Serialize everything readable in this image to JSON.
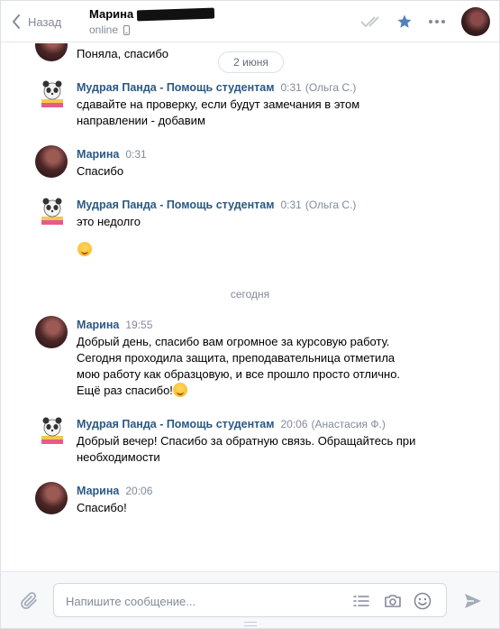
{
  "header": {
    "back_label": "Назад",
    "peer_name": "Марина",
    "peer_status": "online",
    "icons": [
      "double-check-icon",
      "star-icon",
      "more-icon"
    ]
  },
  "messages_area": {
    "date_pill": "2 июня",
    "today_separator": "сегодня"
  },
  "messages": [
    {
      "text": "Поняла, спасибо"
    },
    {
      "author": "Мудрая Панда - Помощь студентам",
      "time": "0:31",
      "sub": "(Ольга С.)",
      "text": "сдавайте на проверку, если будут замечания в этом направлении - добавим"
    },
    {
      "author": "Марина",
      "time": "0:31",
      "text": "Спасибо"
    },
    {
      "author": "Мудрая Панда - Помощь студентам",
      "time": "0:31",
      "sub": "(Ольга С.)",
      "text": "это недолго",
      "emoji": "smile-emoji"
    },
    {
      "author": "Марина",
      "time": "19:55",
      "text": "Добрый день, спасибо вам огромное за курсовую работу. Сегодня проходила защита, преподавательница отметила мою работу как образцовую, и все прошло просто отлично. Ещё раз спасибо!"
    },
    {
      "author": "Мудрая Панда - Помощь студентам",
      "time": "20:06",
      "sub": "(Анастасия Ф.)",
      "text": "Добрый вечер! Спасибо за обратную связь. Обращайтесь при необходимости"
    },
    {
      "author": "Марина",
      "time": "20:06",
      "text": "Спасибо!"
    }
  ],
  "composer": {
    "placeholder": "Напишите сообщение...",
    "icons": [
      "attach-icon",
      "template-list-icon",
      "camera-icon",
      "emoji-icon",
      "send-icon"
    ]
  },
  "colors": {
    "link": "#2a5885",
    "muted": "#828a99",
    "star": "#5181b8"
  }
}
